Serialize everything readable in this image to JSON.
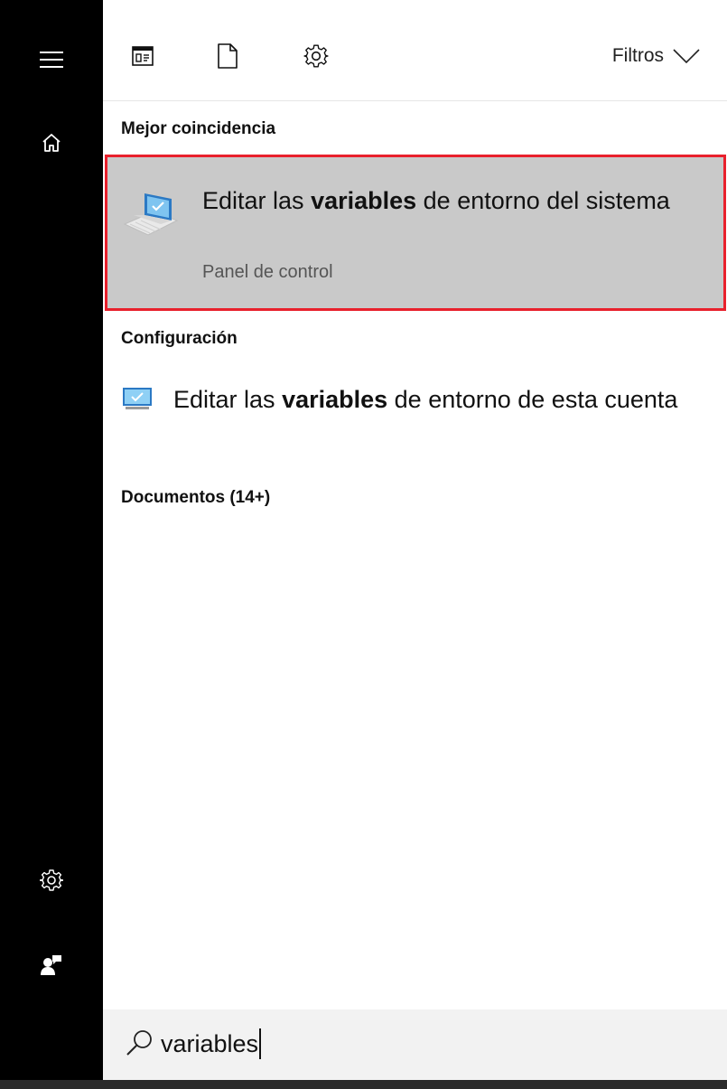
{
  "rail": {
    "items": [
      {
        "icon": "hamburger-menu-icon"
      },
      {
        "icon": "home-icon"
      },
      {
        "icon": "gear-icon"
      },
      {
        "icon": "user-feedback-icon"
      }
    ]
  },
  "toolbar": {
    "icons": [
      "apps-icon",
      "document-icon",
      "settings-icon"
    ],
    "filters_label": "Filtros"
  },
  "sections": {
    "best_match": "Mejor coincidencia",
    "settings": "Configuración",
    "documents": "Documentos (14+)"
  },
  "best_match": {
    "title_pre": "Editar las ",
    "title_bold": "variables",
    "title_post": " de entorno del sistema",
    "subtitle": "Panel de control",
    "highlight_color": "#e8202c"
  },
  "settings_result": {
    "title_pre": "Editar las ",
    "title_bold": "variables",
    "title_post": " de entorno de esta cuenta"
  },
  "search": {
    "value": "variables"
  },
  "colors": {
    "rail": "#000000",
    "selected_bg": "#c9c9c9",
    "searchbar_bg": "#f2f2f2"
  }
}
